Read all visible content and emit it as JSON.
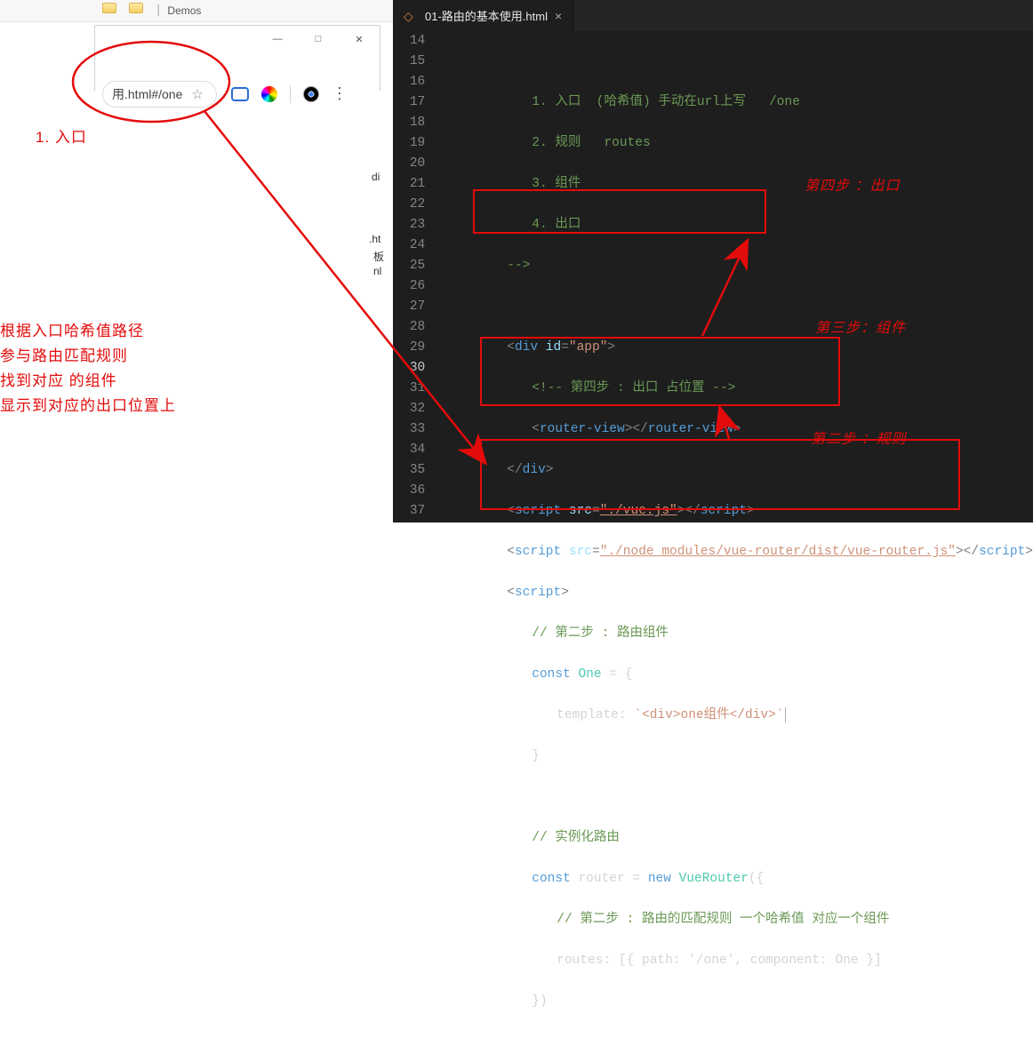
{
  "explorer": {
    "title": "Demos"
  },
  "browser": {
    "url": "用.html#/one",
    "window_buttons": {
      "min": "—",
      "max": "□",
      "close": "✕"
    },
    "toolbar": {
      "menu_glyph": "⋮",
      "star_glyph": "☆"
    }
  },
  "file_fragments": {
    "a": "di",
    "b": ".ht",
    "c": "板",
    "d": "nl"
  },
  "annotations": {
    "left_num_label": "1.  入口",
    "left_block_l1": "根据入口哈希值路径",
    "left_block_l2": "参与路由匹配规则",
    "left_block_l3": "找到对应  的组件",
    "left_block_l4": "显示到对应的出口位置上",
    "step4_label": "第四步 ：出口",
    "step3_label": "第三步：组件",
    "step2_label": "第二步 ：规则"
  },
  "editor": {
    "tab_title": "01-路由的基本使用.html",
    "line_start": 14,
    "line_end": 37,
    "current_line": 30,
    "lines": {
      "l15_num": "1.",
      "l15_a": "入口",
      "l15_b": "(哈希值) 手动在url上写",
      "l15_c": "/one",
      "l16_num": "2.",
      "l16_a": "规则",
      "l16_b": "routes",
      "l17_num": "3.",
      "l17_a": "组件",
      "l18_num": "4.",
      "l18_a": "出口",
      "l19": "-->",
      "l21_id": "\"app\"",
      "l22": "<!-- 第四步 : 出口 占位置 -->",
      "l23_tag": "router-view",
      "l24_close": "div",
      "l25_src": "\"./vue.js\"",
      "l26_src": "\"./node_modules/vue-router/dist/vue-router.js\"",
      "l28": "// 第二步 : 路由组件",
      "l29_name": "One",
      "l30_key": "template:",
      "l30_val": "`<div>one组件</div>`",
      "l33": "// 实例化路由",
      "l34_name": " router ",
      "l34_ctor": "VueRouter",
      "l35": "// 第二步 : 路由的匹配规则 一个哈希值 对应一个组件",
      "l36_key": "routes:",
      "l36_val": "[{ path: '/one', component: One }]"
    }
  }
}
